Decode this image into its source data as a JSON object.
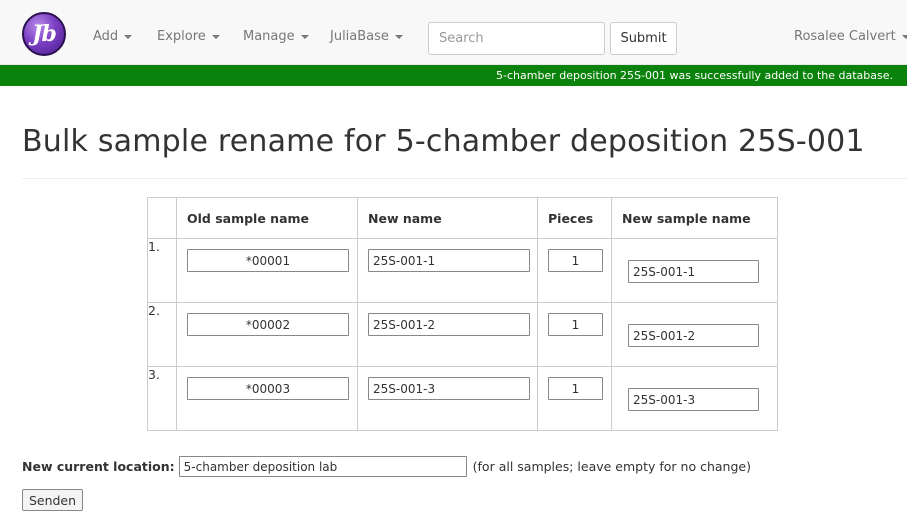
{
  "navbar": {
    "logo_text": "Jb",
    "menus": [
      {
        "label": "Add"
      },
      {
        "label": "Explore"
      },
      {
        "label": "Manage"
      },
      {
        "label": "JuliaBase"
      }
    ],
    "search_placeholder": "Search",
    "submit_label": "Submit",
    "user_name": "Rosalee Calvert",
    "bg_color": "#f8f8f8"
  },
  "alert": {
    "message": "5-chamber deposition 25S-001 was successfully added to the database.",
    "color": "#0b820b"
  },
  "page": {
    "title": "Bulk sample rename for 5-chamber deposition 25S-001"
  },
  "table": {
    "headers": [
      "",
      "Old sample name",
      "New name",
      "Pieces",
      "New sample name"
    ],
    "rows": [
      {
        "index": "1.",
        "old_name": "*00001",
        "new_name": "25S-001-1",
        "pieces": "1",
        "new_sample_name": "25S-001-1"
      },
      {
        "index": "2.",
        "old_name": "*00002",
        "new_name": "25S-001-2",
        "pieces": "1",
        "new_sample_name": "25S-001-2"
      },
      {
        "index": "3.",
        "old_name": "*00003",
        "new_name": "25S-001-3",
        "pieces": "1",
        "new_sample_name": "25S-001-3"
      }
    ]
  },
  "location": {
    "label": "New current location:",
    "value": "5-chamber deposition lab",
    "hint": "(for all samples; leave empty for no change)"
  },
  "form": {
    "send_label": "Senden"
  }
}
